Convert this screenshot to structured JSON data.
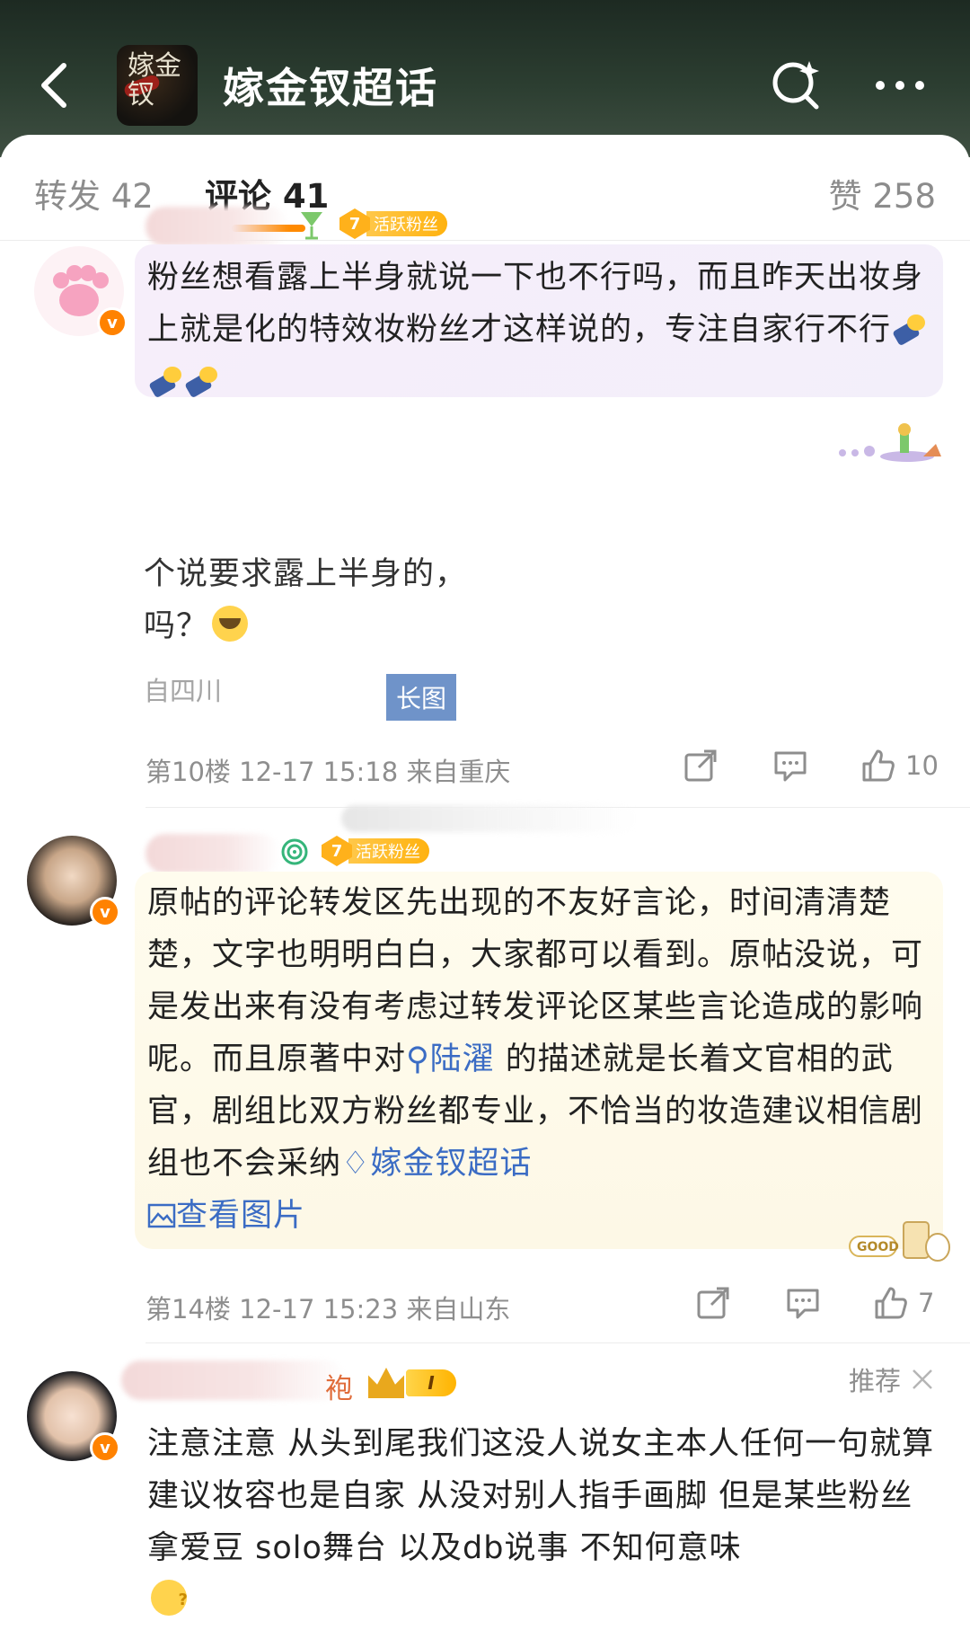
{
  "header": {
    "title": "嫁金钗超话",
    "avatar_text": "嫁金钗"
  },
  "tabs": {
    "repost": "转发 42",
    "comment": "评论 41",
    "like": "赞 258"
  },
  "colors": {
    "accent": "#ff8a00",
    "link": "#3b6cc4",
    "verified": "#ff8200",
    "fan_badge": "#ffb11b"
  },
  "comments": [
    {
      "fan_level": "7",
      "fan_badge": "活跃粉丝",
      "text": "粉丝想看露上半身就说一下也不行吗，而且昨天出妆身上就是化的特效妆粉丝才这样说的，专注自家行不行",
      "quoted_line1": "个说要求露上半身的，",
      "quoted_line2": "吗？",
      "quoted_meta": "自四川",
      "long_image_label": "长图",
      "floor": "第10楼",
      "time": "12-17 15:18",
      "location": "来自重庆",
      "likes": "10"
    },
    {
      "fan_level": "7",
      "fan_badge": "活跃粉丝",
      "text_part1": "原帖的评论转发区先出现的不友好言论，时间清清楚楚，文字也明明白白，大家都可以看到。原帖没说，可是发出来有没有考虑过转发评论区某些言论造成的影响呢。而且原著中对",
      "mention": "陆濯",
      "text_part2": " 的描述就是长着文官相的武官，剧组比双方粉丝都专业，不恰当的妆造建议相信剧组也不会采纳",
      "topic_link": "嫁金钗超话",
      "view_image": "查看图片",
      "sticker_text": "GOOD",
      "floor": "第14楼",
      "time": "12-17 15:23",
      "location": "来自山东",
      "likes": "7"
    },
    {
      "name_suffix": "袍",
      "level": "I",
      "recommend": "推荐",
      "text": "注意注意 从头到尾我们这没人说女主本人任何一句就算建议妆容也是自家 从没对别人指手画脚 但是某些粉丝拿爱豆 solo舞台 以及db说事 不知何意味"
    }
  ]
}
